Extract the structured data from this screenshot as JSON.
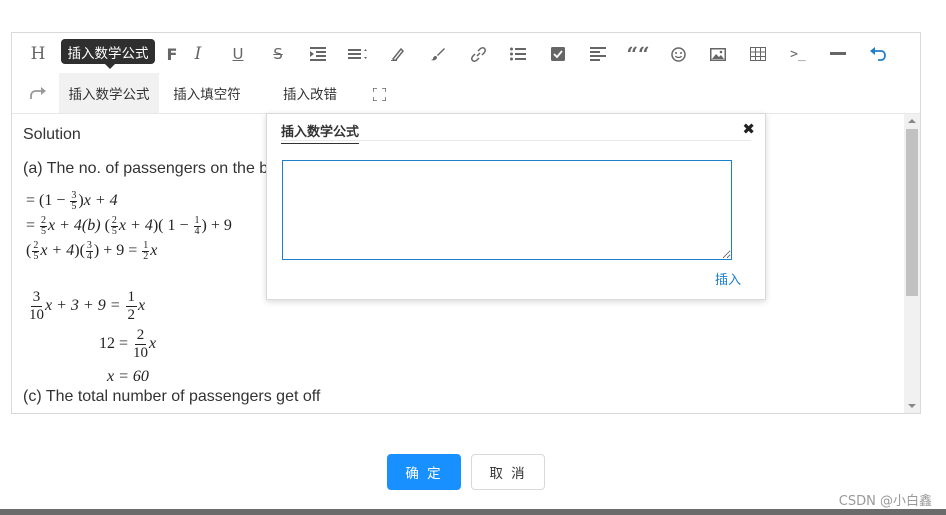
{
  "toolbar": {
    "tooltip": "插入数学公式",
    "heading_glyph": "H",
    "bold_glyph": "F",
    "italic_glyph": "I",
    "underline_glyph": "U",
    "strike_glyph": "S",
    "quote_glyph": "““",
    "code_glyph": ">_",
    "insert_math_label": "插入数学公式",
    "insert_blank_label": "插入填空符",
    "insert_error_label": "插入改错"
  },
  "content": {
    "solution": "Solution",
    "part_a": "(a) The no. of passengers on the b",
    "part_c": "(c) The total number of passengers get off",
    "math": {
      "l1_a": "= ",
      "l1_b": "1 − ",
      "l1_n": "3",
      "l1_d": "5",
      "l1_c": "x + 4",
      "l2_a": "= ",
      "l2_n1": "2",
      "l2_d1": "5",
      "l2_b": "x + 4(b) ",
      "l2_n2": "2",
      "l2_d2": "5",
      "l2_c": "x + 4",
      "l2_d": " 1 − ",
      "l2_n3": "1",
      "l2_d3": "4",
      "l2_e": " + 9",
      "l3_n1": "2",
      "l3_d1": "5",
      "l3_a": "x + 4",
      "l3_n2": "3",
      "l3_d2": "4",
      "l3_b": " + 9 = ",
      "l3_n3": "1",
      "l3_d3": "2",
      "l3_c": "x",
      "l4_n1": "3",
      "l4_d1": "10",
      "l4_a": "x + 3 + 9 = ",
      "l4_n2": "1",
      "l4_d2": "2",
      "l4_b": "x",
      "l5_a": "12 = ",
      "l5_n": "2",
      "l5_d": "10",
      "l5_b": "x",
      "l6": "x = 60"
    }
  },
  "popup": {
    "tab": "插入数学公式",
    "close": "✖",
    "textarea_value": "",
    "insert": "插入"
  },
  "dialog": {
    "ok": "确 定",
    "cancel": "取 消"
  },
  "watermark": "CSDN @小白鑫",
  "colors": {
    "primary": "#1890ff",
    "link": "#1e7fc9",
    "tooltip_bg": "#2f2f2f",
    "undo_icon": "#1e7fc9"
  }
}
